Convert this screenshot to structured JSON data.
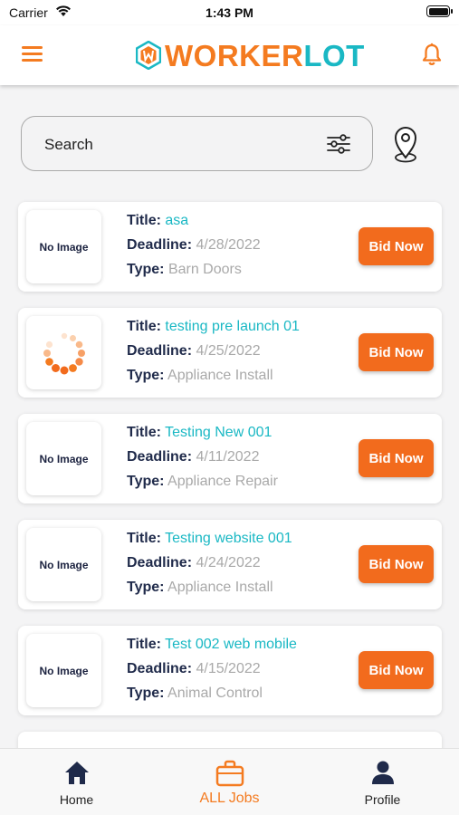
{
  "status_bar": {
    "carrier": "Carrier",
    "time": "1:43 PM"
  },
  "header": {
    "logo_part1": "WORKER",
    "logo_part2": "LOT",
    "brand_orange": "#f47b20",
    "brand_teal": "#1ab8c4"
  },
  "search": {
    "placeholder": "Search"
  },
  "labels": {
    "title": "Title:",
    "deadline": "Deadline:",
    "type": "Type:",
    "no_image": "No Image",
    "bid_button": "Bid Now"
  },
  "jobs": [
    {
      "title": "asa",
      "deadline": "4/28/2022",
      "type": "Barn Doors",
      "image": "no-image"
    },
    {
      "title": "testing pre launch 01",
      "deadline": "4/25/2022",
      "type": "Appliance Install",
      "image": "loading-spinner"
    },
    {
      "title": "Testing New 001",
      "deadline": "4/11/2022",
      "type": "Appliance Repair",
      "image": "no-image"
    },
    {
      "title": "Testing website 001",
      "deadline": "4/24/2022",
      "type": "Appliance Install",
      "image": "no-image"
    },
    {
      "title": " Test 002 web mobile",
      "deadline": "4/15/2022",
      "type": "Animal Control",
      "image": "no-image"
    }
  ],
  "tabs": [
    {
      "label": "Home",
      "icon": "home-icon",
      "active": false
    },
    {
      "label": "ALL Jobs",
      "icon": "briefcase-icon",
      "active": true
    },
    {
      "label": "Profile",
      "icon": "person-icon",
      "active": false
    }
  ]
}
